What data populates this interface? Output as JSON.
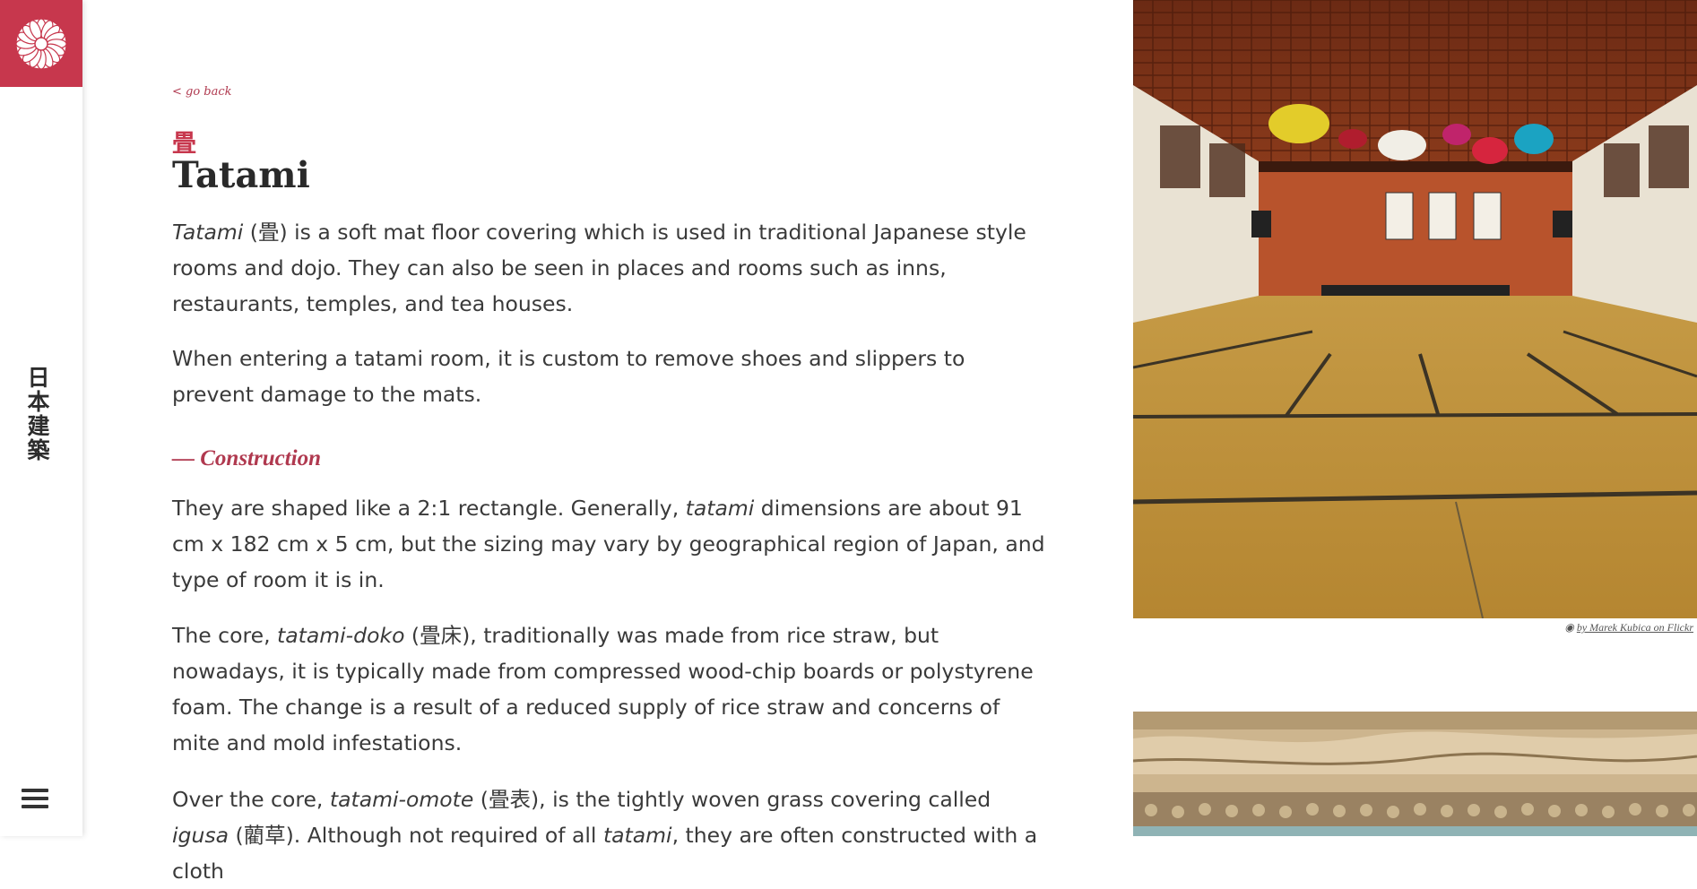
{
  "sidebar": {
    "logo": "chrysanthemum-crest",
    "vertical_title": "日本建築",
    "menu_icon": "hamburger-menu-icon"
  },
  "nav": {
    "go_back": "< go back"
  },
  "article": {
    "kanji": "畳",
    "title": "Tatami",
    "p1": {
      "em": "Tatami",
      "rest": " (畳) is a soft mat floor covering which is used in traditional Japanese style rooms and dojo. They can also be seen in places and rooms such as inns, restaurants, temples, and tea houses."
    },
    "p2": "When entering a tatami room, it is custom to remove shoes and slippers to prevent damage to the mats.",
    "section": "— Construction",
    "p3": {
      "a": "They are shaped like a 2:1 rectangle. Generally, ",
      "em": "tatami",
      "b": " dimensions are about 91 cm x 182 cm x 5 cm, but the sizing may vary by geographical region of Japan, and type of room it is in."
    },
    "p4": {
      "a": "The core, ",
      "em": "tatami-doko",
      "b": " (畳床), traditionally was made from rice straw, but nowadays, it is typically made from compressed wood-chip boards or polystyrene foam. The change is a result of a reduced supply of rice straw and concerns of mite and mold infestations."
    },
    "p5": {
      "a": "Over the core, ",
      "em1": "tatami-omote",
      "b": " (畳表), is the tightly woven grass covering called ",
      "em2": "igusa",
      "c": " (藺草). Although not required of all ",
      "em3": "tatami",
      "d": ", they are often constructed with a cloth"
    }
  },
  "images": {
    "credit": "by Marek Kubica on Flickr",
    "credit_icon": "camera-icon"
  },
  "colors": {
    "accent": "#c7374d",
    "link": "#b0394f"
  }
}
